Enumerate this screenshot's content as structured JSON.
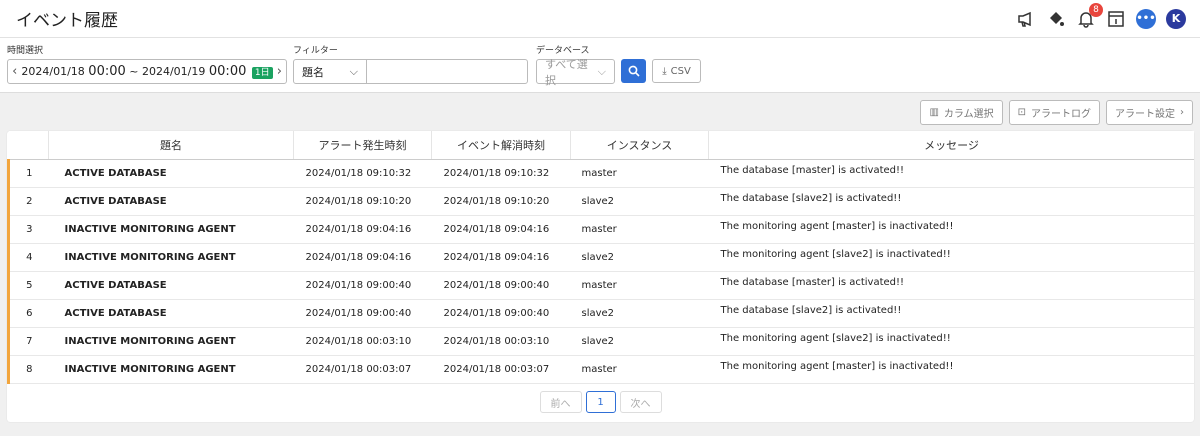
{
  "header": {
    "title": "イベント履歴",
    "notification_count": "8",
    "avatar_letter": "K"
  },
  "filters": {
    "time_label": "時間選択",
    "time_start_date": "2024/01/18",
    "time_start_hm": "00:00",
    "time_sep": "~",
    "time_end_date": "2024/01/19",
    "time_end_hm": "00:00",
    "time_span": "1日",
    "filter_label": "フィルター",
    "filter_field": "題名",
    "filter_text": "",
    "db_label": "データベース",
    "db_value": "すべて選択",
    "csv_label": "CSV"
  },
  "tools": {
    "columns": "カラム選択",
    "alert_log": "アラートログ",
    "alert_settings": "アラート設定"
  },
  "table": {
    "headers": [
      "",
      "題名",
      "アラート発生時刻",
      "イベント解消時刻",
      "インスタンス",
      "メッセージ"
    ],
    "rows": [
      {
        "no": "1",
        "title": "ACTIVE DATABASE",
        "occurred": "2024/01/18 09:10:32",
        "resolved": "2024/01/18 09:10:32",
        "instance": "master",
        "message": "The database [master] is activated!!"
      },
      {
        "no": "2",
        "title": "ACTIVE DATABASE",
        "occurred": "2024/01/18 09:10:20",
        "resolved": "2024/01/18 09:10:20",
        "instance": "slave2",
        "message": "The database [slave2] is activated!!"
      },
      {
        "no": "3",
        "title": "INACTIVE MONITORING AGENT",
        "occurred": "2024/01/18 09:04:16",
        "resolved": "2024/01/18 09:04:16",
        "instance": "master",
        "message": "The monitoring agent [master] is inactivated!!"
      },
      {
        "no": "4",
        "title": "INACTIVE MONITORING AGENT",
        "occurred": "2024/01/18 09:04:16",
        "resolved": "2024/01/18 09:04:16",
        "instance": "slave2",
        "message": "The monitoring agent [slave2] is inactivated!!"
      },
      {
        "no": "5",
        "title": "ACTIVE DATABASE",
        "occurred": "2024/01/18 09:00:40",
        "resolved": "2024/01/18 09:00:40",
        "instance": "master",
        "message": "The database [master] is activated!!"
      },
      {
        "no": "6",
        "title": "ACTIVE DATABASE",
        "occurred": "2024/01/18 09:00:40",
        "resolved": "2024/01/18 09:00:40",
        "instance": "slave2",
        "message": "The database [slave2] is activated!!"
      },
      {
        "no": "7",
        "title": "INACTIVE MONITORING AGENT",
        "occurred": "2024/01/18 00:03:10",
        "resolved": "2024/01/18 00:03:10",
        "instance": "slave2",
        "message": "The monitoring agent [slave2] is inactivated!!"
      },
      {
        "no": "8",
        "title": "INACTIVE MONITORING AGENT",
        "occurred": "2024/01/18 00:03:07",
        "resolved": "2024/01/18 00:03:07",
        "instance": "master",
        "message": "The monitoring agent [master] is inactivated!!"
      }
    ]
  },
  "pagination": {
    "prev": "前へ",
    "current": "1",
    "next": "次へ"
  },
  "colors": {
    "accent": "#2f6fd6",
    "row_marker": "#f2a53d",
    "badge": "#e8453c",
    "span_tag": "#1aa260"
  }
}
